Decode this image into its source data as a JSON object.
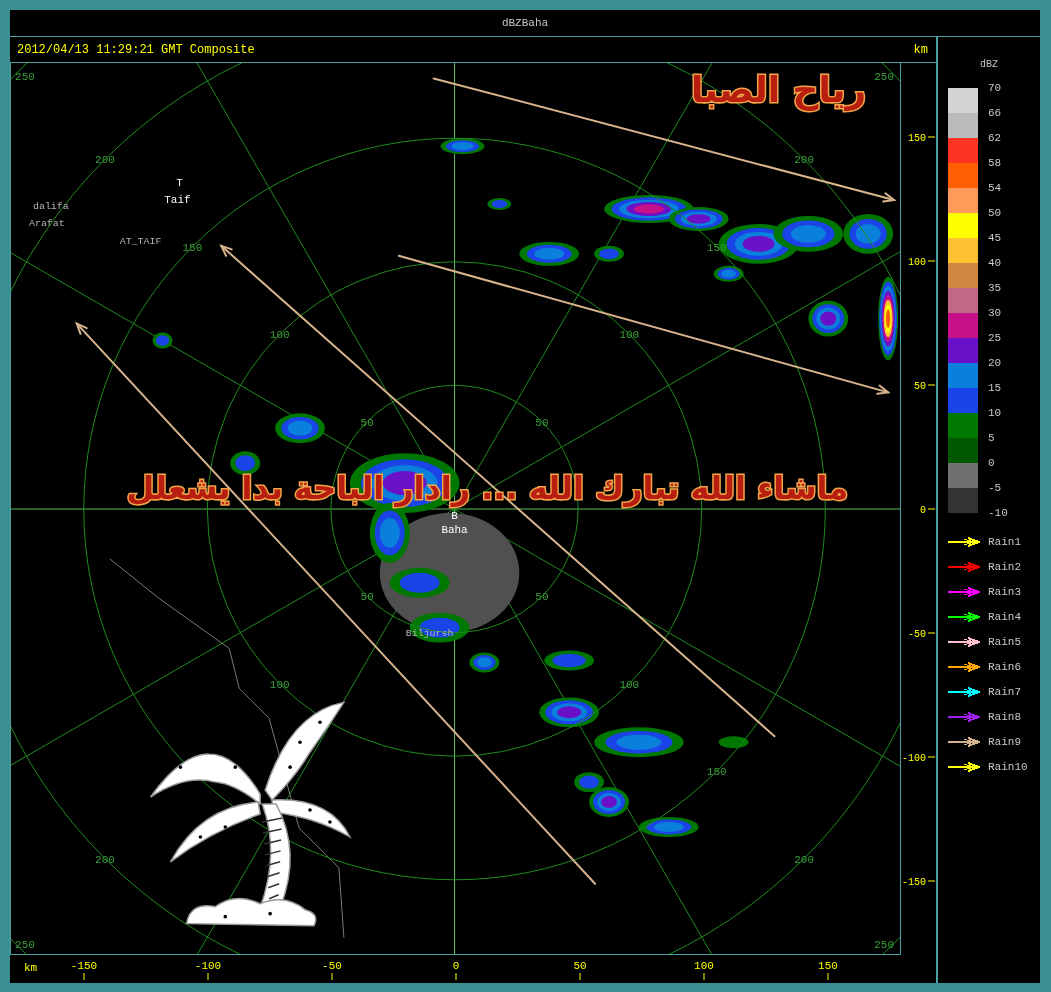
{
  "window": {
    "title": "dBZBaha"
  },
  "header": {
    "timestamp": "2012/04/13 11:29:21 GMT Composite",
    "unit": "km"
  },
  "overlay": {
    "title": "رياح الصبا",
    "caption": "ماشاء الله تبارك الله ... رادار الباحة بدا يشعلل"
  },
  "map": {
    "rings": [
      {
        "labels": {
          "nw": "50",
          "ne": "50",
          "sw": "50",
          "se": "50"
        }
      },
      {
        "labels": {
          "nw": "100",
          "ne": "100",
          "sw": "100",
          "se": "100"
        }
      },
      {
        "labels": {
          "nw": "150",
          "ne": "150",
          "se": "150"
        }
      },
      {
        "labels": {
          "nw": "200",
          "ne": "200",
          "sw": "200",
          "se": "200"
        }
      },
      {
        "labels": {
          "nw": "250",
          "ne": "250",
          "sw": "250",
          "se": "250"
        }
      }
    ],
    "places": [
      {
        "label": "T",
        "kind": "station"
      },
      {
        "label": "Taif",
        "kind": "station"
      },
      {
        "label": "dalifa",
        "kind": "place"
      },
      {
        "label": "Arafat",
        "kind": "place"
      },
      {
        "label": "AT_TAIF",
        "kind": "place"
      },
      {
        "label": "B",
        "kind": "station"
      },
      {
        "label": "Baha",
        "kind": "station"
      },
      {
        "label": "Biljursh",
        "kind": "place"
      }
    ]
  },
  "right_axis": {
    "ticks": [
      "150",
      "100",
      "50",
      "0",
      "-50",
      "-100",
      "-150"
    ]
  },
  "bottom_axis": {
    "unit": "km",
    "ticks": [
      "-150",
      "-100",
      "-50",
      "0",
      "50",
      "100",
      "150"
    ]
  },
  "legend": {
    "title": "dBZ",
    "bands": [
      {
        "label": "70",
        "color": "#d4d4d4"
      },
      {
        "label": "66",
        "color": "#bbbbbb"
      },
      {
        "label": "62",
        "color": "#ff3322"
      },
      {
        "label": "58",
        "color": "#ff5f00"
      },
      {
        "label": "54",
        "color": "#ff9a5a"
      },
      {
        "label": "50",
        "color": "#ffff00"
      },
      {
        "label": "45",
        "color": "#fcc232"
      },
      {
        "label": "40",
        "color": "#d08840"
      },
      {
        "label": "35",
        "color": "#c06888"
      },
      {
        "label": "30",
        "color": "#c81088"
      },
      {
        "label": "25",
        "color": "#6a10c8"
      },
      {
        "label": "20",
        "color": "#0a80dc"
      },
      {
        "label": "15",
        "color": "#1a44e8"
      },
      {
        "label": "10",
        "color": "#007800"
      },
      {
        "label": "5",
        "color": "#005800"
      },
      {
        "label": "0",
        "color": "#707070"
      },
      {
        "label": "-5",
        "color": "#333333"
      }
    ],
    "bottom_label": "-10",
    "tracks": [
      {
        "label": "Rain1",
        "color": "#ffff00"
      },
      {
        "label": "Rain2",
        "color": "#ff0000"
      },
      {
        "label": "Rain3",
        "color": "#ff00ff"
      },
      {
        "label": "Rain4",
        "color": "#00ff00"
      },
      {
        "label": "Rain5",
        "color": "#ffc0cb"
      },
      {
        "label": "Rain6",
        "color": "#ffa500"
      },
      {
        "label": "Rain7",
        "color": "#00ffff"
      },
      {
        "label": "Rain8",
        "color": "#a020f0"
      },
      {
        "label": "Rain9",
        "color": "#d2b48c"
      },
      {
        "label": "Rain10",
        "color": "#ffff00"
      }
    ]
  }
}
